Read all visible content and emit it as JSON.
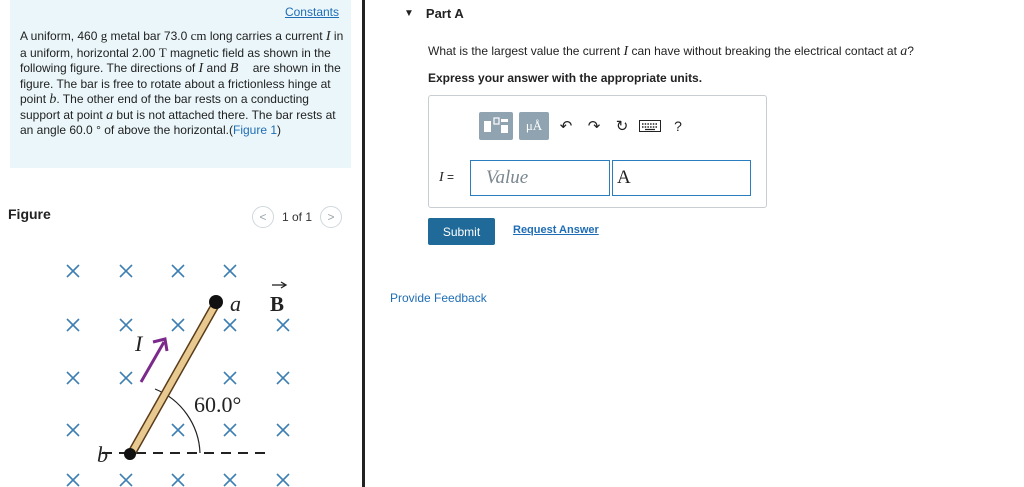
{
  "problem": {
    "constants_link": "Constants",
    "text_parts": {
      "p1": "A uniform, 460 ",
      "p1_unit": "g",
      "p2": " metal bar 73.0 ",
      "p2_unit": "cm",
      "p3": " long carries a current ",
      "p3_var": "I",
      "p4": " in a uniform, horizontal 2.00 ",
      "p4_unit": "T",
      "p5": " magnetic field as shown in the following figure. The directions of ",
      "p5_var": "I",
      "p6": " and ",
      "p6_var": "B⃗",
      "p7": " are shown in the figure. The bar is free to rotate about a frictionless hinge at point ",
      "p7_var": "b",
      "p8": ". The other end of the bar rests on a conducting support at point ",
      "p8_var": "a",
      "p9": " but is not attached there. The bar rests at an angle 60.0 ",
      "p9_deg": "°",
      "p10": " of above the horizontal.(",
      "figure_link": "Figure 1",
      "p11": ")"
    }
  },
  "figure": {
    "heading": "Figure",
    "pager_prev": "<",
    "pager_text": "1 of 1",
    "pager_next": ">",
    "labels": {
      "current": "I",
      "point_a": "a",
      "point_b": "b",
      "field": "B",
      "angle": "60.0°"
    },
    "colors": {
      "bar": "#e8c98f",
      "bar_edge": "#5a3b1a",
      "arrow": "#7b2a8c",
      "field_x": "#3d7fb3"
    }
  },
  "part": {
    "title": "Part A",
    "question_pre": "What is the largest value the current ",
    "question_var": "I",
    "question_mid": " can have without breaking the electrical contact at ",
    "question_var2": "a",
    "question_post": "?",
    "instruction": "Express your answer with the appropriate units.",
    "toolbar": {
      "units_label": "μÅ",
      "undo_icon": "↶",
      "redo_icon": "↷",
      "reset_icon": "↻",
      "help_label": "?"
    },
    "answer_label_var": "I",
    "answer_label_eq": " =",
    "value_placeholder": "Value",
    "unit_value": "A",
    "submit_label": "Submit",
    "request_label": "Request Answer"
  },
  "feedback_label": "Provide Feedback"
}
